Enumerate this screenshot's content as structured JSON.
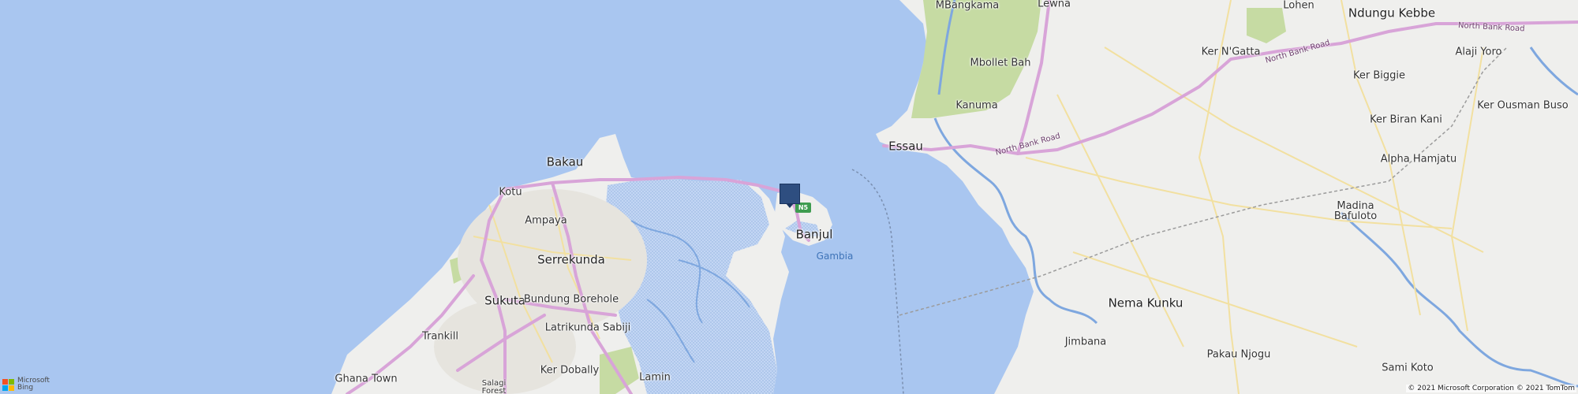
{
  "map": {
    "colors": {
      "water": "#a9c6f0",
      "land": "#efefed",
      "park": "#c6dba3",
      "mangrove": "#c9d9f5",
      "major_road": "#d8a4d8",
      "minor_road": "#f2e0a0",
      "urban": "#e6e4de",
      "pin": "#2e4e80"
    },
    "labels": {
      "mbangkama": "MBangkama",
      "lewna": "Lewna",
      "lohen": "Lohen",
      "ndungu_kebbe": "Ndungu Kebbe",
      "alaji_yoro": "Alaji Yoro",
      "ker_n_gatta": "Ker N'Gatta",
      "mbollet_bah": "Mbollet Bah",
      "ker_biggie": "Ker Biggie",
      "kanuma": "Kanuma",
      "ker_ousman_buso": "Ker Ousman Buso",
      "ker_biran_kani": "Ker Biran Kani",
      "essau": "Essau",
      "alpha_hamjatu": "Alpha Hamjatu",
      "bakau": "Bakau",
      "kotu": "Kotu",
      "madina_bafuloto": "Madina\nBafuloto",
      "ampaya": "Ampaya",
      "banjul": "Banjul",
      "gambia": "Gambia",
      "serrekunda": "Serrekunda",
      "sukuta": "Sukuta",
      "bundung_borehole": "Bundung Borehole",
      "nema_kunku": "Nema Kunku",
      "latrikunda_sabiji": "Latrikunda Sabiji",
      "trankill": "Trankill",
      "jimbana": "Jimbana",
      "pakau_njogu": "Pakau Njogu",
      "sami_koto": "Sami Koto",
      "ghana_town": "Ghana Town",
      "ker_dobally": "Ker Dobally",
      "lamin": "Lamin",
      "salagi_forest": "Salagi\nForest"
    },
    "roads": {
      "north_bank_road": "North Bank Road",
      "shield_n5": "N5"
    },
    "attribution": {
      "logo_text": "Microsoft\nBing",
      "copyright": "© 2021 Microsoft Corporation © 2021 TomTom"
    },
    "icons": {
      "pin": "location-pin-icon",
      "logo": "microsoft-logo-icon"
    }
  }
}
